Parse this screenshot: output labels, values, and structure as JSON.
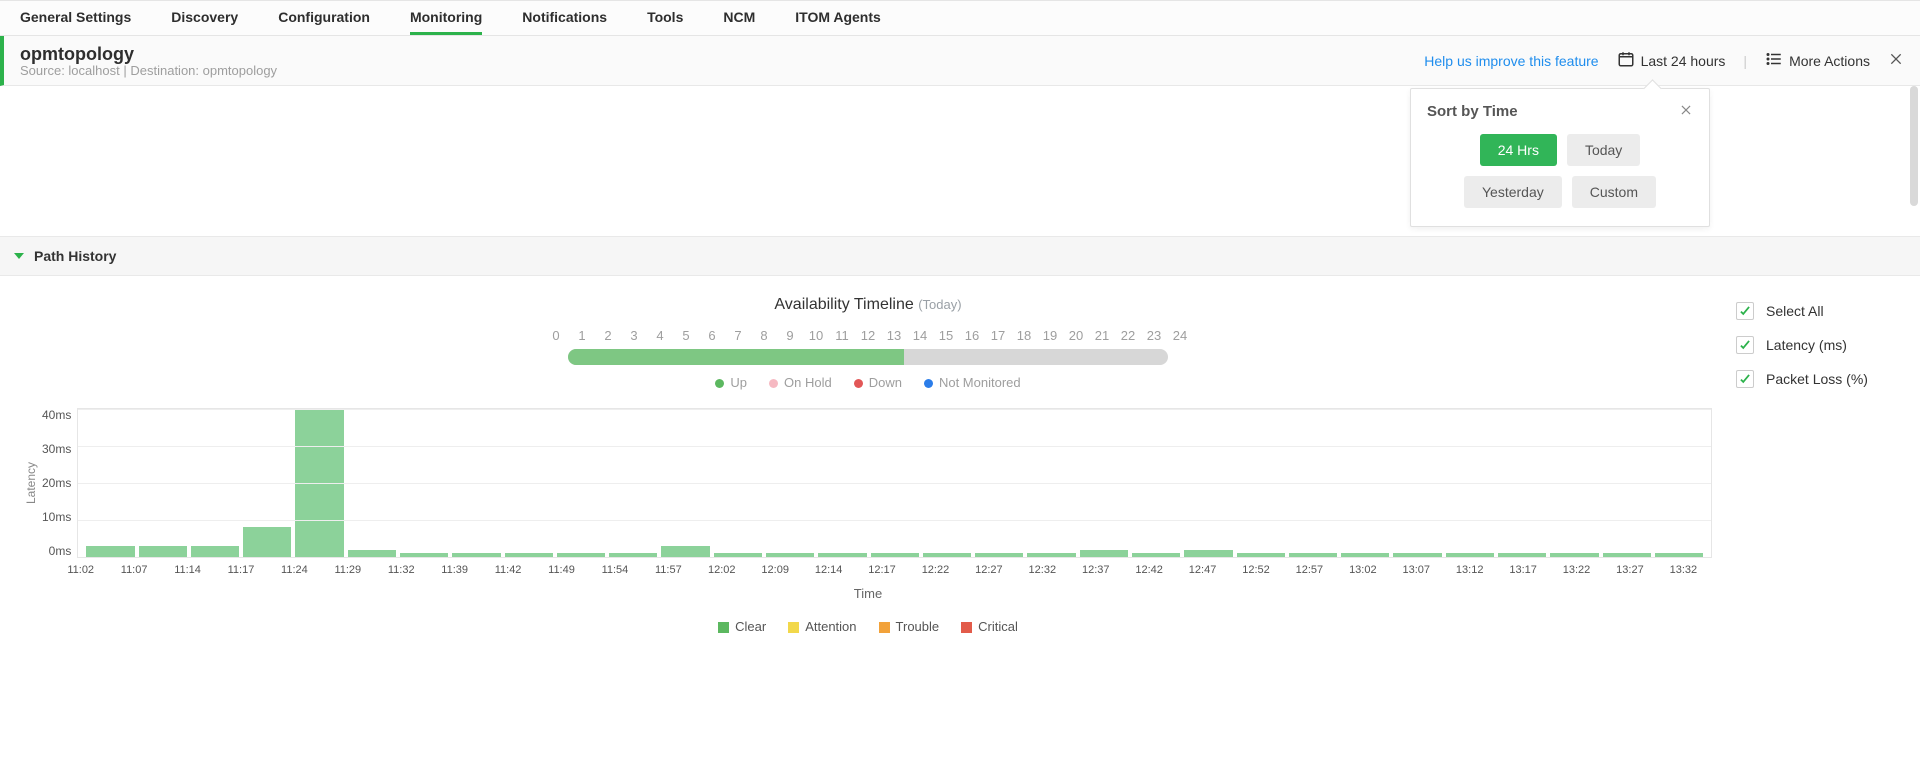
{
  "tabs": [
    {
      "label": "General Settings"
    },
    {
      "label": "Discovery"
    },
    {
      "label": "Configuration"
    },
    {
      "label": "Monitoring",
      "active": true
    },
    {
      "label": "Notifications"
    },
    {
      "label": "Tools"
    },
    {
      "label": "NCM"
    },
    {
      "label": "ITOM Agents"
    }
  ],
  "header": {
    "title": "opmtopology",
    "source": "Source: localhost",
    "sep": " | ",
    "dest": "Destination: opmtopology",
    "help_link": "Help us improve this feature",
    "time_range": "Last 24 hours",
    "more_actions": "More Actions"
  },
  "sort_popover": {
    "title": "Sort by Time",
    "opts": [
      {
        "label": "24 Hrs",
        "on": true
      },
      {
        "label": "Today"
      },
      {
        "label": "Yesterday"
      },
      {
        "label": "Custom"
      }
    ]
  },
  "section": {
    "path_history": "Path History"
  },
  "right_checks": [
    {
      "label": "Select All"
    },
    {
      "label": "Latency (ms)"
    },
    {
      "label": "Packet Loss (%)"
    }
  ],
  "availability": {
    "title": "Availability Timeline",
    "sub": "(Today)",
    "hours": [
      "0",
      "1",
      "2",
      "3",
      "4",
      "5",
      "6",
      "7",
      "8",
      "9",
      "10",
      "11",
      "12",
      "13",
      "14",
      "15",
      "16",
      "17",
      "18",
      "19",
      "20",
      "21",
      "22",
      "23",
      "24"
    ],
    "legend": [
      {
        "cls": "dot-up",
        "label": "Up"
      },
      {
        "cls": "dot-hold",
        "label": "On Hold"
      },
      {
        "cls": "dot-down",
        "label": "Down"
      },
      {
        "cls": "dot-nm",
        "label": "Not Monitored"
      }
    ]
  },
  "chart_data": {
    "type": "bar",
    "title": "",
    "xlabel": "Time",
    "ylabel": "Latency",
    "ylim": [
      0,
      40
    ],
    "y_ticks": [
      "40ms",
      "30ms",
      "20ms",
      "10ms",
      "0ms"
    ],
    "categories": [
      "11:02",
      "11:07",
      "11:14",
      "11:17",
      "11:24",
      "11:29",
      "11:32",
      "11:39",
      "11:42",
      "11:49",
      "11:54",
      "11:57",
      "12:02",
      "12:09",
      "12:14",
      "12:17",
      "12:22",
      "12:27",
      "12:32",
      "12:37",
      "12:42",
      "12:47",
      "12:52",
      "12:57",
      "13:02",
      "13:07",
      "13:12",
      "13:17",
      "13:22",
      "13:27",
      "13:32"
    ],
    "values": [
      3,
      3,
      3,
      8,
      40,
      2,
      1,
      1,
      1,
      1,
      1,
      3,
      1,
      1,
      1,
      1,
      1,
      1,
      1,
      2,
      1,
      2,
      1,
      1,
      1,
      1,
      1,
      1,
      1,
      1,
      1
    ],
    "legend": [
      {
        "cls": "sq-clear",
        "label": "Clear"
      },
      {
        "cls": "sq-att",
        "label": "Attention"
      },
      {
        "cls": "sq-tr",
        "label": "Trouble"
      },
      {
        "cls": "sq-crit",
        "label": "Critical"
      }
    ]
  }
}
